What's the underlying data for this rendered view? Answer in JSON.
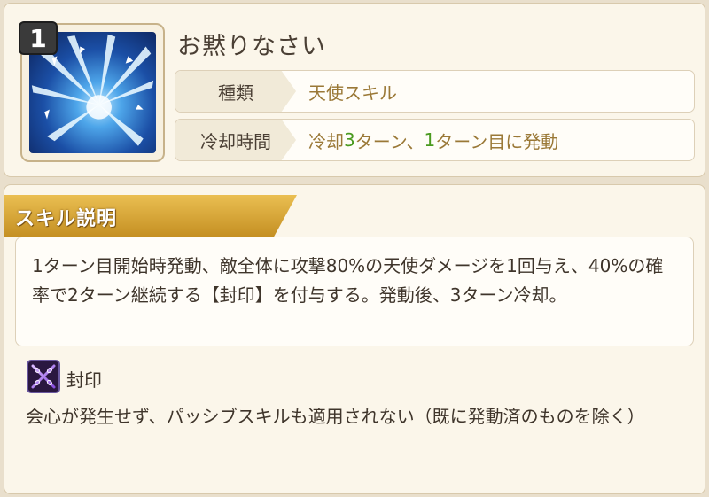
{
  "skill": {
    "level": "1",
    "name": "お黙りなさい",
    "icon": "ice-shard-burst-icon",
    "type_label": "種類",
    "type_value": "天使スキル",
    "cooldown_label": "冷却時間",
    "cooldown_parts": [
      "冷却",
      "3",
      "ターン、",
      "1",
      "ターン目に発動"
    ]
  },
  "description": {
    "section_title": "スキル説明",
    "text": "1ターン目開始時発動、敵全体に攻撃80%の天使ダメージを1回与え、40%の確率で2ターン継続する【封印】を付与する。発動後、3ターン冷却。"
  },
  "status_effect": {
    "icon": "crossed-chains-icon",
    "name": "封印",
    "description": "会心が発生せず、パッシブスキルも適用されない（既に発動済のものを除く）"
  },
  "colors": {
    "accent_gold": "#d4a236",
    "value_text": "#9a7836",
    "number_green": "#4a9a1f"
  }
}
